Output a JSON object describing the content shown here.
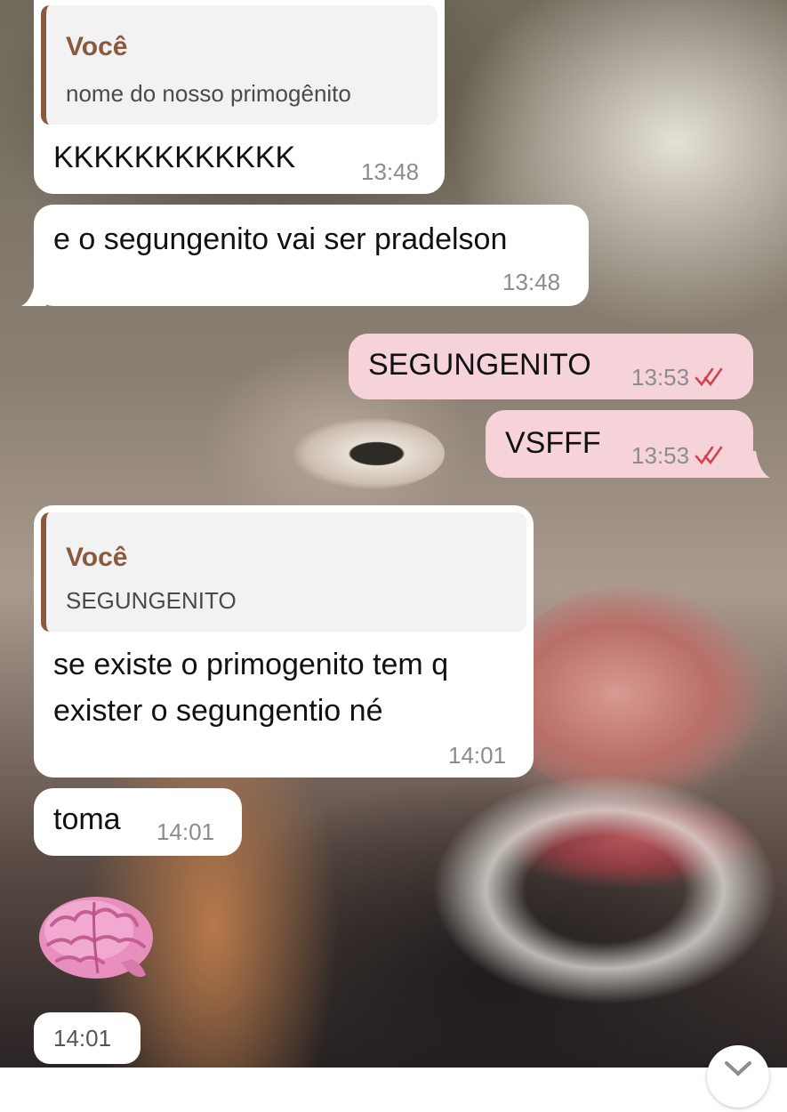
{
  "chat": {
    "messages": [
      {
        "direction": "incoming",
        "reply_author": "Você",
        "reply_text": "nome do nosso primogênito",
        "text": "KKKKKKKKKKKK",
        "time": "13:48"
      },
      {
        "direction": "incoming",
        "text": "e o segungenito vai ser pradelson",
        "time": "13:48"
      },
      {
        "direction": "outgoing",
        "text": "SEGUNGENITO",
        "time": "13:53",
        "status": "read"
      },
      {
        "direction": "outgoing",
        "text": "VSFFF",
        "time": "13:53",
        "status": "read"
      },
      {
        "direction": "incoming",
        "reply_author": "Você",
        "reply_text": "SEGUNGENITO",
        "text_line1": "se existe o primogenito tem q",
        "text_line2": "exister o segungentio né",
        "time": "14:01"
      },
      {
        "direction": "incoming",
        "text": "toma",
        "time": "14:01"
      },
      {
        "direction": "incoming",
        "type": "sticker",
        "sticker_icon": "brain-icon",
        "time": "14:01"
      }
    ]
  },
  "colors": {
    "incoming_bubble": "#ffffff",
    "outgoing_bubble": "#f6d3d9",
    "reply_accent": "#8a5a3e",
    "read_ticks": "#d0434f",
    "timestamp": "#8c8c8c"
  },
  "scroll_button_icon": "chevron-down-icon"
}
